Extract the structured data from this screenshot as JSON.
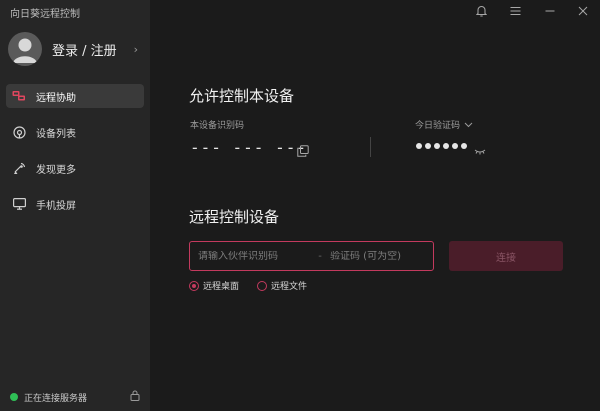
{
  "app": {
    "title": "向日葵远程控制"
  },
  "account": {
    "label": "登录 / 注册",
    "avatar_icon": "user-avatar-icon",
    "chevron": "›"
  },
  "nav": {
    "items": [
      {
        "label": "远程协助",
        "icon": "remote-assist-icon",
        "active": true
      },
      {
        "label": "设备列表",
        "icon": "device-list-icon",
        "active": false
      },
      {
        "label": "发现更多",
        "icon": "discover-icon",
        "active": false
      },
      {
        "label": "手机投屏",
        "icon": "screen-cast-icon",
        "active": false
      }
    ]
  },
  "status": {
    "text": "正在连接服务器",
    "color": "#2fbf56"
  },
  "window": {
    "controls": [
      "bell-icon",
      "menu-icon",
      "minimize-icon",
      "close-icon"
    ]
  },
  "allow": {
    "title": "允许控制本设备",
    "device_id_label": "本设备识别码",
    "device_id": "--- --- ---",
    "code_label": "今日验证码",
    "code_masked": "●●●●●●"
  },
  "remote": {
    "title": "远程控制设备",
    "partner_placeholder": "请输入伙伴识别码",
    "separator": "-",
    "verify_placeholder": "验证码 (可为空)",
    "connect_label": "连接",
    "options": [
      {
        "label": "远程桌面",
        "checked": true
      },
      {
        "label": "远程文件",
        "checked": false
      }
    ]
  },
  "colors": {
    "accent": "#c33a5e",
    "sidebar_bg": "#262626",
    "main_bg": "#1b1b1b"
  }
}
